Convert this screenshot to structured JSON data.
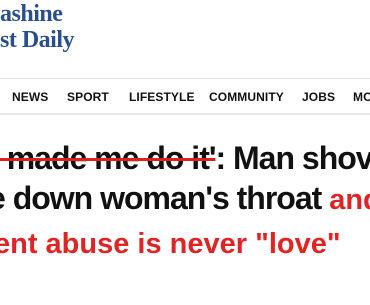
{
  "logo": {
    "line1": "ashine",
    "line2": "st Daily"
  },
  "nav": {
    "items": [
      {
        "label": "NEWS"
      },
      {
        "label": "SPORT"
      },
      {
        "label": "LIFESTYLE"
      },
      {
        "label": "COMMUNITY"
      },
      {
        "label": "JOBS"
      },
      {
        "label": "MO"
      }
    ]
  },
  "headline": {
    "line1_struck": "e made me do it'",
    "line1_rest": ": Man shov",
    "line2_dark": "e down woman's throat ",
    "line2_red": "and",
    "line3_red": "ent abuse is never \"love\""
  },
  "colors": {
    "logo_blue": "#2a4f8f",
    "headline_red": "#e02424",
    "text_dark": "#111111"
  }
}
